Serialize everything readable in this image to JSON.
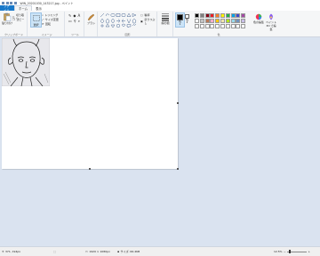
{
  "window": {
    "title": "WIN_20201030_143217.jpg - ペイント"
  },
  "tabs": [
    {
      "label": "ファイル"
    },
    {
      "label": "ホーム"
    },
    {
      "label": "表示"
    }
  ],
  "ribbon": {
    "clipboard": {
      "paste": "貼り付け",
      "cut": "切り取り",
      "copy": "コピー",
      "group": "クリップボード"
    },
    "image": {
      "select": "選択",
      "crop": "トリミング",
      "resize": "サイズ変更",
      "rotate": "回転",
      "group": "イメージ"
    },
    "tools": {
      "group": "ツール"
    },
    "brushes": {
      "label": "ブラシ"
    },
    "shapes": {
      "outline": "輪郭",
      "fill": "塗りつぶし",
      "group": "図形"
    },
    "size": {
      "label": "線の幅"
    },
    "colors": {
      "color1": "色\n1",
      "color2": "色\n2",
      "edit": "色の編集",
      "paint3d": "ペイント 3D で編集",
      "group": "色"
    }
  },
  "palette": [
    "#000000",
    "#7f7f7f",
    "#880015",
    "#ed1c24",
    "#ff7f27",
    "#fff200",
    "#22b14c",
    "#00a2e8",
    "#3f48cc",
    "#a349a4",
    "#ffffff",
    "#c3c3c3",
    "#b97a57",
    "#ffaec9",
    "#ffc90e",
    "#efe4b0",
    "#b5e61d",
    "#99d9ea",
    "#7092be",
    "#c8bfe7",
    "#ffffff",
    "#ffffff",
    "#ffffff",
    "#ffffff",
    "#ffffff",
    "#ffffff",
    "#ffffff",
    "#ffffff",
    "#ffffff",
    "#ffffff"
  ],
  "status": {
    "position": "371, 194px",
    "selection": "",
    "canvas_size": "1920 × 1080px",
    "file_size": "サイズ: 66.4KB",
    "zoom": "12.5%"
  }
}
